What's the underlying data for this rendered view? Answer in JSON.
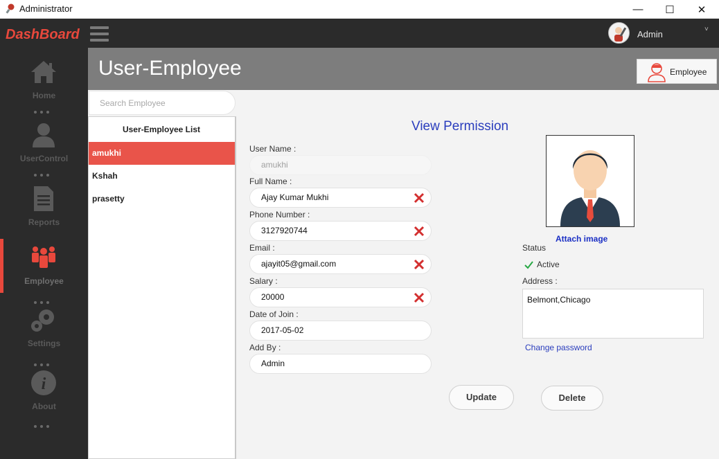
{
  "window": {
    "title": "Administrator",
    "min": "—",
    "max": "☐",
    "close": "✕"
  },
  "topbar": {
    "brand": "DashBoard",
    "user_name": "Admin",
    "chevron": "˅"
  },
  "sidebar": {
    "items": [
      {
        "label": "Home",
        "icon": "home-icon"
      },
      {
        "label": "UserControl",
        "icon": "user-icon"
      },
      {
        "label": "Reports",
        "icon": "document-icon"
      },
      {
        "label": "Employee",
        "icon": "employees-icon",
        "active": true
      },
      {
        "label": "Settings",
        "icon": "gear-icon"
      },
      {
        "label": "About",
        "icon": "info-icon"
      }
    ]
  },
  "header": {
    "title": "User-Employee",
    "button_label": "Employee"
  },
  "search": {
    "placeholder": "Search Employee"
  },
  "employee_list": {
    "title": "User-Employee List",
    "items": [
      "amukhi",
      "Kshah",
      "prasetty"
    ],
    "selected": "amukhi"
  },
  "form": {
    "heading": "View Permission",
    "user_name": {
      "label": "User Name :",
      "value": "amukhi"
    },
    "full_name": {
      "label": "Full Name :",
      "value": "Ajay Kumar Mukhi"
    },
    "phone": {
      "label": "Phone Number :",
      "value": "3127920744"
    },
    "email": {
      "label": "Email :",
      "value": "ajayit05@gmail.com"
    },
    "salary": {
      "label": "Salary :",
      "value": "20000"
    },
    "date_of_join": {
      "label": "Date of Join :",
      "value": "2017-05-02"
    },
    "add_by": {
      "label": "Add By :",
      "value": "Admin"
    }
  },
  "profile": {
    "attach_label": "Attach image",
    "status_label": "Status",
    "status_value": "Active",
    "address_label": "Address :",
    "address_value": "Belmont,Chicago",
    "change_password": "Change password"
  },
  "actions": {
    "update": "Update",
    "delete": "Delete"
  },
  "colors": {
    "accent": "#e8483c",
    "sidebar": "#2b2b2b",
    "header": "#7d7d7d",
    "link": "#2a3dbd"
  }
}
